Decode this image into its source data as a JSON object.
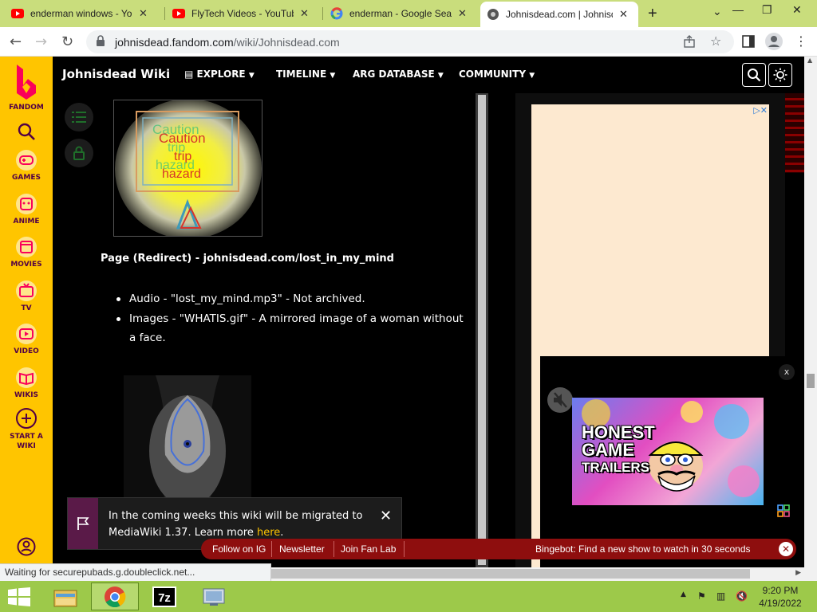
{
  "browser": {
    "tabs": [
      {
        "title": "enderman windows - YouTube",
        "icon": "youtube-icon"
      },
      {
        "title": "FlyTech Videos - YouTube",
        "icon": "youtube-icon"
      },
      {
        "title": "enderman - Google Search",
        "icon": "google-icon"
      },
      {
        "title": "Johnisdead.com | Johnisdead Wiki",
        "icon": "fandom-icon",
        "active": true
      }
    ],
    "new_tab": "+",
    "window_controls": {
      "dropdown": "⌄",
      "minimize": "—",
      "restore": "❐",
      "close": "✕"
    },
    "url_host": "johnisdead.fandom.com",
    "url_path": "/wiki/Johnisdead.com"
  },
  "rail": {
    "brand": "FANDOM",
    "items": [
      {
        "label": "GAMES",
        "icon": "games-icon"
      },
      {
        "label": "ANIME",
        "icon": "anime-icon"
      },
      {
        "label": "MOVIES",
        "icon": "movies-icon"
      },
      {
        "label": "TV",
        "icon": "tv-icon"
      },
      {
        "label": "VIDEO",
        "icon": "video-icon"
      },
      {
        "label": "WIKIS",
        "icon": "wikis-icon"
      }
    ],
    "start_wiki_1": "START A",
    "start_wiki_2": "WIKI"
  },
  "header": {
    "title": "Johnisdead Wiki",
    "nav": [
      {
        "label": "EXPLORE"
      },
      {
        "label": "TIMELINE"
      },
      {
        "label": "ARG DATABASE"
      },
      {
        "label": "COMMUNITY"
      }
    ]
  },
  "article": {
    "image1_text": [
      "Caution",
      "trip",
      "hazard"
    ],
    "redirect_heading": "Page (Redirect) - johnisdead.com/lost_in_my_mind",
    "bullets": [
      "Audio - \"lost_my_mind.mp3\" - Not archived.",
      "Images - \"WHATIS.gif\" - A mirrored image of a woman without a face."
    ]
  },
  "ad": {
    "video_title_1": "HONEST",
    "video_title_2": "GAME",
    "video_title_3": "TRAILERS",
    "close": "x"
  },
  "banner": {
    "text": "In the coming weeks this wiki will be migrated to MediaWiki 1.37. Learn more ",
    "link": "here",
    "suffix": "."
  },
  "footer_bar": {
    "links": [
      "Follow on IG",
      "Newsletter",
      "Join Fan Lab"
    ],
    "bingebot": "Bingebot: Find a new show to watch in 30 seconds"
  },
  "status": "Waiting for securepubads.g.doubleclick.net...",
  "taskbar": {
    "time": "9:20 PM",
    "date": "4/19/2022",
    "apps": [
      "file-explorer-icon",
      "chrome-icon",
      "7zip-icon",
      "control-panel-icon"
    ],
    "sevenzip": "7z"
  },
  "colors": {
    "fandom_yellow": "#ffc500",
    "tabbar": "#c9dd7c",
    "taskbar": "#9dc94a",
    "footer_red": "#8e0e0e"
  }
}
